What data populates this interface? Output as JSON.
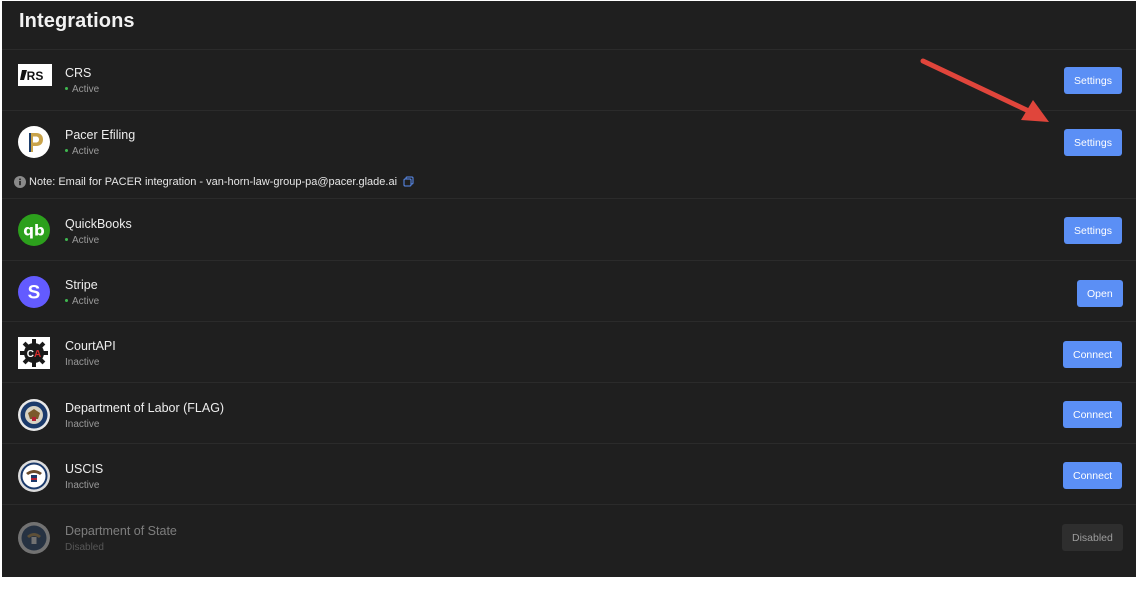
{
  "header": {
    "title": "Integrations"
  },
  "note": {
    "text": "Note: Email for PACER integration - van-horn-law-group-pa@pacer.glade.ai",
    "icon": "info-icon",
    "copy_icon": "copy-icon"
  },
  "integrations": [
    {
      "name": "CRS",
      "status": "Active",
      "button": "Settings",
      "logo": "crs-logo"
    },
    {
      "name": "Pacer Efiling",
      "status": "Active",
      "button": "Settings",
      "logo": "pacer-logo"
    },
    {
      "name": "QuickBooks",
      "status": "Active",
      "button": "Settings",
      "logo": "quickbooks-logo"
    },
    {
      "name": "Stripe",
      "status": "Active",
      "button": "Open",
      "logo": "stripe-logo"
    },
    {
      "name": "CourtAPI",
      "status": "Inactive",
      "button": "Connect",
      "logo": "courtapi-logo"
    },
    {
      "name": "Department of Labor (FLAG)",
      "status": "Inactive",
      "button": "Connect",
      "logo": "dol-seal"
    },
    {
      "name": "USCIS",
      "status": "Inactive",
      "button": "Connect",
      "logo": "uscis-seal"
    },
    {
      "name": "Department of State",
      "status": "Disabled",
      "button": "Disabled",
      "logo": "dos-seal"
    }
  ],
  "colors": {
    "background": "#1f1f1f",
    "button": "#5b8ff5",
    "active_dot": "#3fb950",
    "arrow": "#e0453b",
    "disabled_button": "#2e2e2e"
  }
}
